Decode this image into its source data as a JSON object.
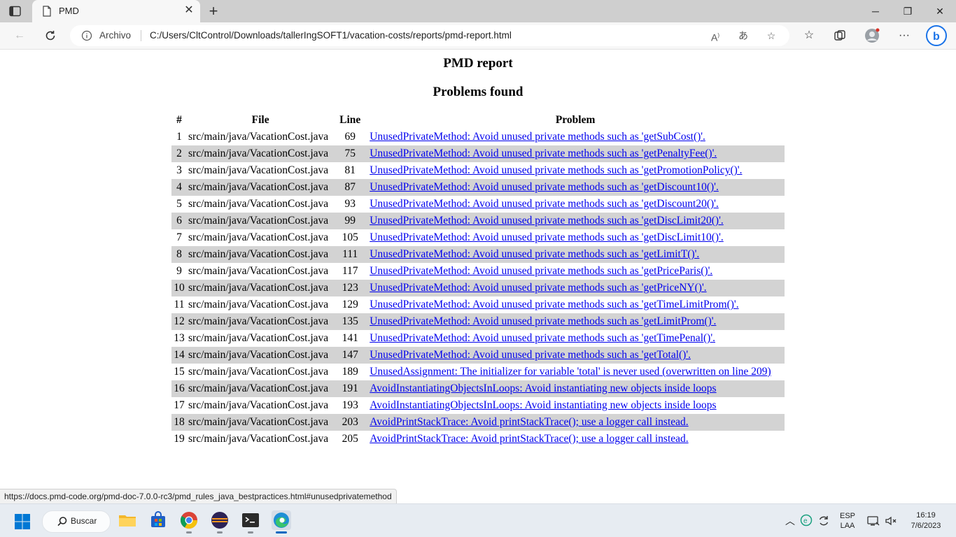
{
  "browser": {
    "tab_title": "PMD",
    "location_label": "Archivo",
    "url": "C:/Users/CltControl/Downloads/tallerIngSOFT1/vacation-costs/reports/pmd-report.html",
    "status_url": "https://docs.pmd-code.org/pmd-doc-7.0.0-rc3/pmd_rules_java_bestpractices.html#unusedprivatemethod"
  },
  "page": {
    "title": "PMD report",
    "subtitle": "Problems found",
    "columns": {
      "num": "#",
      "file": "File",
      "line": "Line",
      "problem": "Problem"
    },
    "rows": [
      {
        "n": "1",
        "file": "src/main/java/VacationCost.java",
        "line": "69",
        "problem": "UnusedPrivateMethod: Avoid unused private methods such as 'getSubCost()'."
      },
      {
        "n": "2",
        "file": "src/main/java/VacationCost.java",
        "line": "75",
        "problem": "UnusedPrivateMethod: Avoid unused private methods such as 'getPenaltyFee()'."
      },
      {
        "n": "3",
        "file": "src/main/java/VacationCost.java",
        "line": "81",
        "problem": "UnusedPrivateMethod: Avoid unused private methods such as 'getPromotionPolicy()'."
      },
      {
        "n": "4",
        "file": "src/main/java/VacationCost.java",
        "line": "87",
        "problem": "UnusedPrivateMethod: Avoid unused private methods such as 'getDiscount10()'."
      },
      {
        "n": "5",
        "file": "src/main/java/VacationCost.java",
        "line": "93",
        "problem": "UnusedPrivateMethod: Avoid unused private methods such as 'getDiscount20()'."
      },
      {
        "n": "6",
        "file": "src/main/java/VacationCost.java",
        "line": "99",
        "problem": "UnusedPrivateMethod: Avoid unused private methods such as 'getDiscLimit20()'."
      },
      {
        "n": "7",
        "file": "src/main/java/VacationCost.java",
        "line": "105",
        "problem": "UnusedPrivateMethod: Avoid unused private methods such as 'getDiscLimit10()'."
      },
      {
        "n": "8",
        "file": "src/main/java/VacationCost.java",
        "line": "111",
        "problem": "UnusedPrivateMethod: Avoid unused private methods such as 'getLimitT()'."
      },
      {
        "n": "9",
        "file": "src/main/java/VacationCost.java",
        "line": "117",
        "problem": "UnusedPrivateMethod: Avoid unused private methods such as 'getPriceParis()'."
      },
      {
        "n": "10",
        "file": "src/main/java/VacationCost.java",
        "line": "123",
        "problem": "UnusedPrivateMethod: Avoid unused private methods such as 'getPriceNY()'."
      },
      {
        "n": "11",
        "file": "src/main/java/VacationCost.java",
        "line": "129",
        "problem": "UnusedPrivateMethod: Avoid unused private methods such as 'getTimeLimitProm()'."
      },
      {
        "n": "12",
        "file": "src/main/java/VacationCost.java",
        "line": "135",
        "problem": "UnusedPrivateMethod: Avoid unused private methods such as 'getLimitProm()'."
      },
      {
        "n": "13",
        "file": "src/main/java/VacationCost.java",
        "line": "141",
        "problem": "UnusedPrivateMethod: Avoid unused private methods such as 'getTimePenal()'."
      },
      {
        "n": "14",
        "file": "src/main/java/VacationCost.java",
        "line": "147",
        "problem": "UnusedPrivateMethod: Avoid unused private methods such as 'getTotal()'."
      },
      {
        "n": "15",
        "file": "src/main/java/VacationCost.java",
        "line": "189",
        "problem": "UnusedAssignment: The initializer for variable 'total' is never used (overwritten on line 209)"
      },
      {
        "n": "16",
        "file": "src/main/java/VacationCost.java",
        "line": "191",
        "problem": "AvoidInstantiatingObjectsInLoops: Avoid instantiating new objects inside loops"
      },
      {
        "n": "17",
        "file": "src/main/java/VacationCost.java",
        "line": "193",
        "problem": "AvoidInstantiatingObjectsInLoops: Avoid instantiating new objects inside loops"
      },
      {
        "n": "18",
        "file": "src/main/java/VacationCost.java",
        "line": "203",
        "problem": "AvoidPrintStackTrace: Avoid printStackTrace(); use a logger call instead."
      },
      {
        "n": "19",
        "file": "src/main/java/VacationCost.java",
        "line": "205",
        "problem": "AvoidPrintStackTrace: Avoid printStackTrace(); use a logger call instead."
      }
    ]
  },
  "taskbar": {
    "search_label": "Buscar",
    "lang_top": "ESP",
    "lang_bottom": "LAA",
    "time": "16:19",
    "date": "7/6/2023"
  },
  "colors": {
    "link": "#0000ee",
    "row_alt": "#d3d3d3",
    "edge_blue": "#0067c0"
  }
}
